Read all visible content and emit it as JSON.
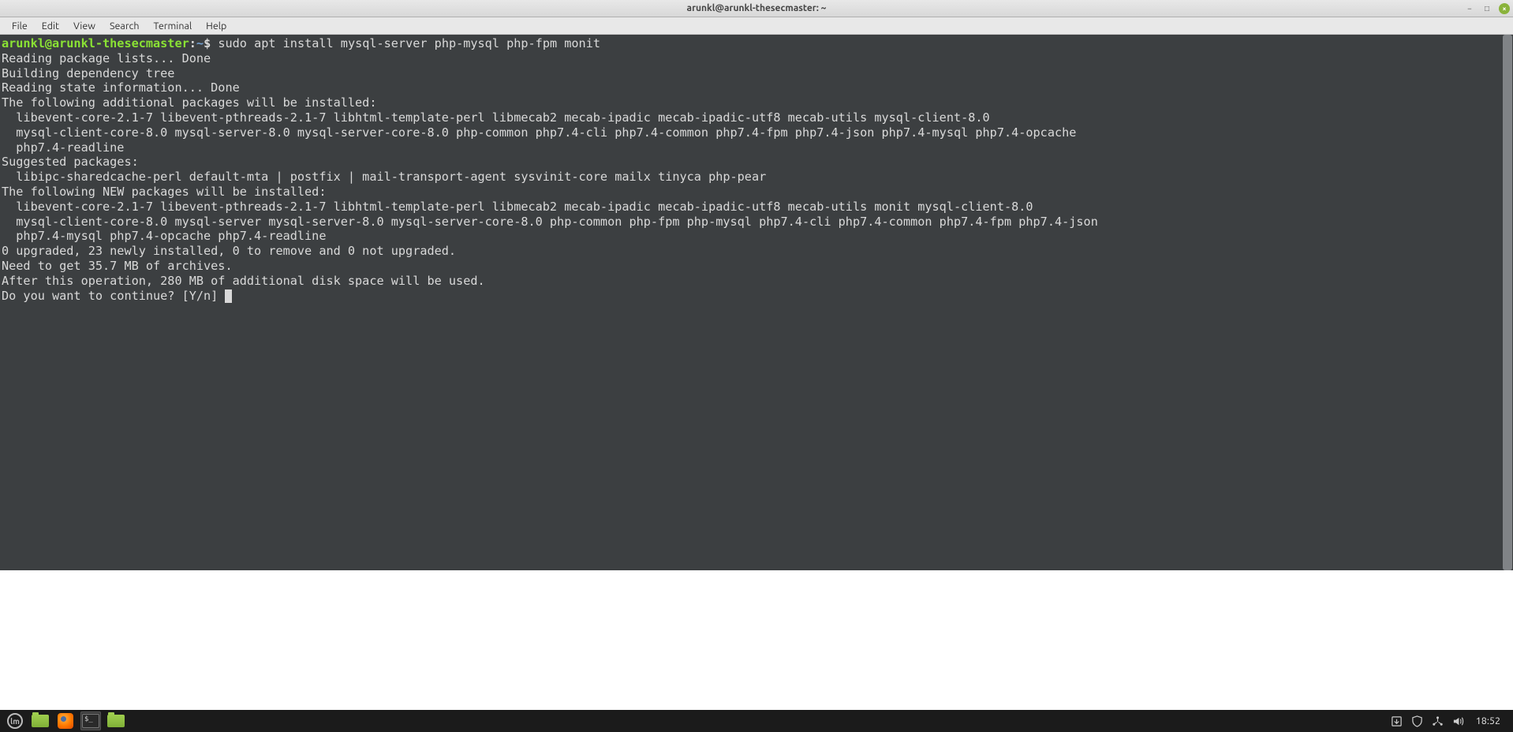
{
  "window": {
    "title": "arunkl@arunkl-thesecmaster: ~"
  },
  "titlebar_controls": {
    "minimize": "−",
    "maximize": "□",
    "close": "×"
  },
  "menu": {
    "items": [
      "File",
      "Edit",
      "View",
      "Search",
      "Terminal",
      "Help"
    ]
  },
  "prompt": {
    "user_host": "arunkl@arunkl-thesecmaster",
    "colon": ":",
    "path": "~",
    "dollar": "$"
  },
  "command": " sudo apt install mysql-server php-mysql php-fpm monit",
  "output_lines": [
    "Reading package lists... Done",
    "Building dependency tree",
    "Reading state information... Done",
    "The following additional packages will be installed:",
    "  libevent-core-2.1-7 libevent-pthreads-2.1-7 libhtml-template-perl libmecab2 mecab-ipadic mecab-ipadic-utf8 mecab-utils mysql-client-8.0",
    "  mysql-client-core-8.0 mysql-server-8.0 mysql-server-core-8.0 php-common php7.4-cli php7.4-common php7.4-fpm php7.4-json php7.4-mysql php7.4-opcache",
    "  php7.4-readline",
    "Suggested packages:",
    "  libipc-sharedcache-perl default-mta | postfix | mail-transport-agent sysvinit-core mailx tinyca php-pear",
    "The following NEW packages will be installed:",
    "  libevent-core-2.1-7 libevent-pthreads-2.1-7 libhtml-template-perl libmecab2 mecab-ipadic mecab-ipadic-utf8 mecab-utils monit mysql-client-8.0",
    "  mysql-client-core-8.0 mysql-server mysql-server-8.0 mysql-server-core-8.0 php-common php-fpm php-mysql php7.4-cli php7.4-common php7.4-fpm php7.4-json",
    "  php7.4-mysql php7.4-opcache php7.4-readline",
    "0 upgraded, 23 newly installed, 0 to remove and 0 not upgraded.",
    "Need to get 35.7 MB of archives.",
    "After this operation, 280 MB of additional disk space will be used.",
    "Do you want to continue? [Y/n] "
  ],
  "panel": {
    "clock": "18:52",
    "launchers": {
      "menu": "lm",
      "files": "files",
      "firefox": "firefox",
      "terminal": "$_",
      "files2": "files"
    }
  }
}
